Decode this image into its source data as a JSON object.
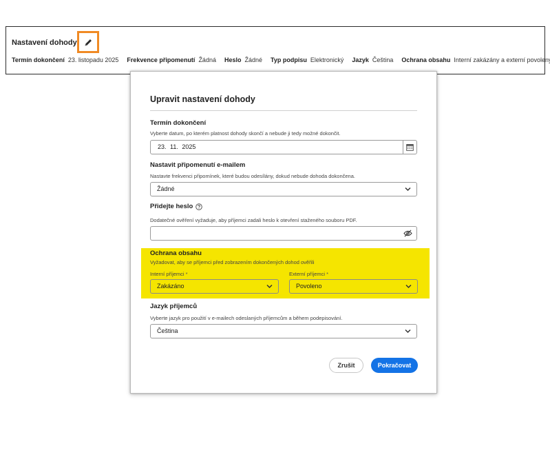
{
  "summary": {
    "title": "Nastavení dohody",
    "items": [
      {
        "key": "Termín dokončení",
        "value": "23. listopadu 2025"
      },
      {
        "key": "Frekvence připomenutí",
        "value": "Žádná"
      },
      {
        "key": "Heslo",
        "value": "Žádné"
      },
      {
        "key": "Typ podpisu",
        "value": "Elektronický"
      },
      {
        "key": "Jazyk",
        "value": "Čeština"
      },
      {
        "key": "Ochrana obsahu",
        "value": "Interní zakázány a externí povoleny"
      }
    ],
    "edit_icon": "pencil-icon",
    "edit_highlight_color": "#f08a24"
  },
  "dialog": {
    "title": "Upravit nastavení dohody",
    "deadline": {
      "title": "Termín dokončení",
      "description": "Vyberte datum, po kterém platnost dohody skončí a nebude ji tedy možné dokončit.",
      "value": "23.  11.  2025",
      "icon": "calendar-icon"
    },
    "reminder": {
      "title": "Nastavit připomenutí e-mailem",
      "description": "Nastavte frekvenci připomínek, které budou odesílány, dokud nebude dohoda dokončena.",
      "value": "Žádné"
    },
    "password": {
      "title": "Přidejte heslo",
      "help_icon": "help-circle-icon",
      "description": "Dodatečné ověření vyžaduje, aby příjemci zadali heslo k otevření staženého souboru PDF.",
      "value": "",
      "icon": "eye-slash-icon"
    },
    "protection": {
      "title": "Ochrana obsahu",
      "description": "Vyžadovat, aby se příjemci před zobrazením dokončených dohod ověřili",
      "internal_label": "Interní příjemci",
      "internal_value": "Zakázáno",
      "external_label": "Externí příjemci",
      "external_value": "Povoleno",
      "required_mark": "*",
      "highlight_color": "#f5e500"
    },
    "language": {
      "title": "Jazyk příjemců",
      "description": "Vyberte jazyk pro použití v e-mailech odeslaných příjemcům a během podepisování.",
      "value": "Čeština"
    },
    "cancel_label": "Zrušit",
    "continue_label": "Pokračovat",
    "accent_color": "#1473e6"
  }
}
